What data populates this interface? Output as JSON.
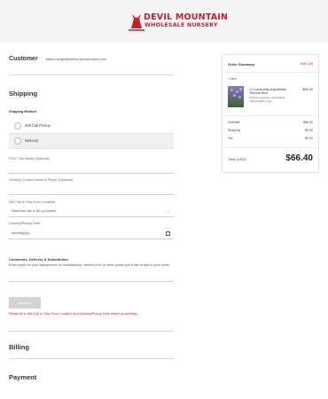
{
  "brand": {
    "line1": "DEVIL MOUNTAIN",
    "line2": "WHOLESALE NURSERY",
    "color": "#c8202a"
  },
  "customer": {
    "heading": "Customer",
    "email": "bakoo.weight@californiarotoscapes.com"
  },
  "shipping": {
    "heading": "Shipping",
    "method_label": "Shipping Method",
    "options": [
      {
        "label": "Will Call Pickup",
        "selected": false
      },
      {
        "label": "Delivery",
        "selected": true
      }
    ],
    "fields": {
      "po_label": "PO# / Job Name (Optional)",
      "po_value": "",
      "contact_label": "Delivery Contact Name & Phone (Optional)",
      "contact_value": "",
      "location_label": "Will Call or Ship From Location",
      "location_value": "Select As site a 4th up locator",
      "date_label": "Delivery/Pickup Date",
      "date_value": "mm/dd/yyyy"
    },
    "comments_heading": "Comments, Delivery & Substitution",
    "comments_help": "Enter notes for your salesperson on substitutions, delivery info or other points you'd like to add to your order",
    "comments_value": "",
    "continue_label": "Continue",
    "error_text": "Please fill in Will Call or Ship From Location and Delivery/Pickup Date before proceeding"
  },
  "billing": {
    "heading": "Billing"
  },
  "payment": {
    "heading": "Payment"
  },
  "order_summary": {
    "title": "Order Summary",
    "edit_label": "Edit Cart",
    "items_count": "1 Item",
    "product": {
      "name": "1 x Lavandula angustifolia 'Hidcote Blue'",
      "meta": "Hidcote Lavender, angustifolia 'Hidcote Blue' 1 gal",
      "price": "$66.40"
    },
    "subtotal_label": "Subtotal",
    "subtotal": "$66.40",
    "shipping_label": "Shipping",
    "shipping": "$0.00",
    "tax_label": "Tax",
    "tax": "$0.00",
    "total_label": "Total (USD)",
    "total": "$66.40"
  }
}
